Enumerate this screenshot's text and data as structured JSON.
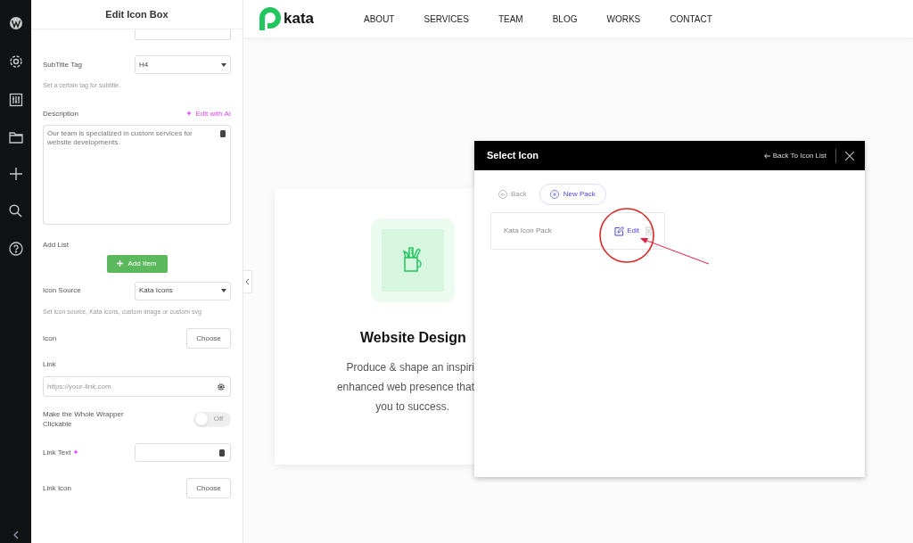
{
  "panel": {
    "title": "Edit Icon Box",
    "subtitle_tag": {
      "label": "SubTitle Tag",
      "value": "H4",
      "help": "Set a certain tag for subtitle."
    },
    "description": {
      "label": "Description",
      "ai_link": "Edit with AI",
      "value": "Our team is specialized in custom services for website developments."
    },
    "add_list": {
      "label": "Add List",
      "button": "Add Item"
    },
    "icon_source": {
      "label": "Icon Source",
      "value": "Kata Icons",
      "help": "Set icon source, Kata icons, custom image or custom svg"
    },
    "icon": {
      "label": "Icon",
      "button": "Choose"
    },
    "link": {
      "label": "Link",
      "placeholder": "https://your-link.com"
    },
    "wrapper_clickable": {
      "label": "Make the Whole Wrapper Clickable",
      "on": false,
      "state_text": "Off"
    },
    "link_text": {
      "label": "Link Text"
    },
    "link_icon": {
      "label": "Link Icon",
      "button": "Choose"
    }
  },
  "site": {
    "logo": "kata",
    "nav": [
      "ABOUT",
      "SERVICES",
      "TEAM",
      "BLOG",
      "WORKS",
      "CONTACT"
    ],
    "card": {
      "title": "Website Design",
      "lines": [
        "Produce & shape an inspiri",
        "enhanced web presence that",
        "you to success."
      ]
    }
  },
  "modal": {
    "title": "Select Icon",
    "back_link": "Back To Icon List",
    "back": "Back",
    "new_pack": "New Pack",
    "packs": [
      {
        "name": "Kata Icon Pack",
        "edit": "Edit"
      }
    ]
  }
}
